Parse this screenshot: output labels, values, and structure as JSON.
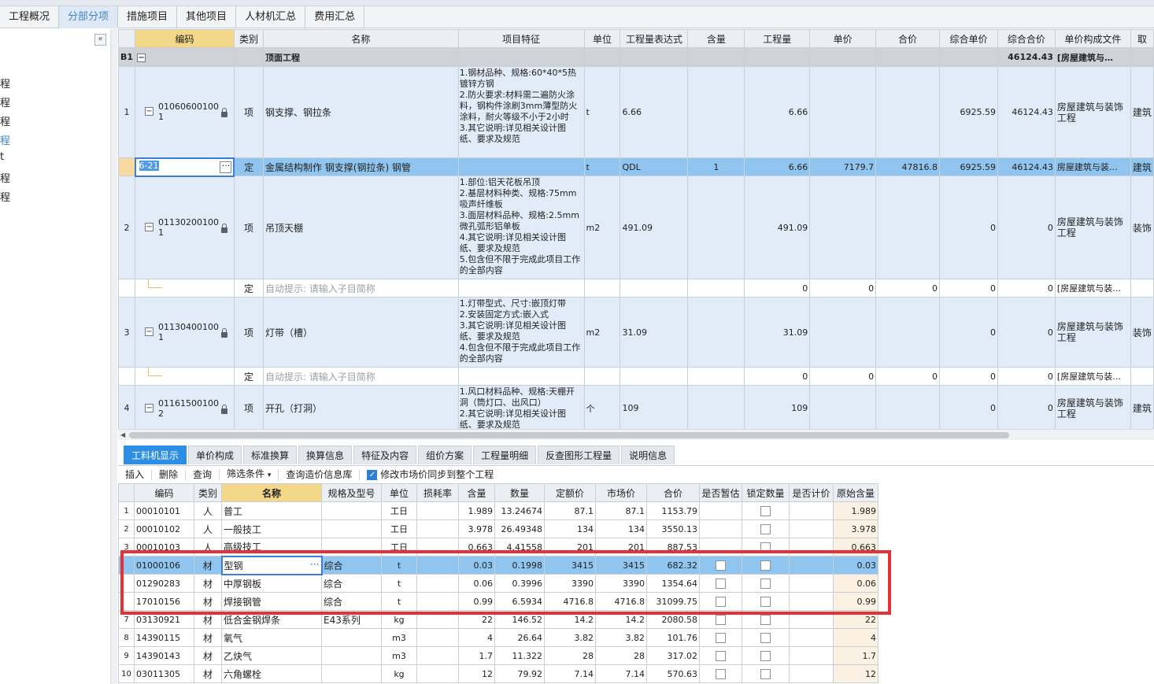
{
  "top_tabs": [
    "工程概况",
    "分部分项",
    "措施项目",
    "其他项目",
    "人材机汇总",
    "费用汇总"
  ],
  "active_top_tab": 1,
  "sidebar": {
    "collapse_label": "«",
    "items": [
      "程",
      "程",
      "程",
      "程",
      "t",
      "程",
      "程"
    ],
    "active_index": 3
  },
  "grid": {
    "headers": [
      "编码",
      "类别",
      "名称",
      "项目特征",
      "单位",
      "工程量表达式",
      "含量",
      "工程量",
      "单价",
      "合价",
      "综合单价",
      "综合合价",
      "单价构成文件",
      "取"
    ],
    "section": {
      "code": "B1",
      "toggle": "−",
      "name": "顶面工程",
      "total": "46124.43",
      "file": "[房屋建筑与…"
    },
    "rows": [
      {
        "no": "1",
        "code": "01060600100 1",
        "type": "项",
        "name": "钢支撑、钢拉条",
        "feature": "1.钢材品种、规格:60*40*5热镀锌方钢\n2.防火要求:材料需二遍防火涂料，钢构件涂刷3mm薄型防火涂料，耐火等级不小于2小时\n3.其它说明:详见相关设计图纸、要求及规范",
        "unit": "t",
        "expr": "6.66",
        "content": "",
        "qty": "6.66",
        "price": "",
        "amount": "",
        "cprice": "6925.59",
        "camount": "46124.43",
        "file": "房屋建筑与装饰工程",
        "fee": "建筑"
      },
      {
        "no": "",
        "code": "6-21",
        "type": "定",
        "name": "金属结构制作 钢支撑(钢拉条) 钢管",
        "feature": "",
        "unit": "t",
        "expr": "QDL",
        "content": "1",
        "qty": "6.66",
        "price": "7179.7",
        "amount": "47816.8",
        "cprice": "6925.59",
        "camount": "46124.43",
        "file": "房屋建筑与装…",
        "fee": "建筑"
      },
      {
        "no": "2",
        "code": "01130200100 1",
        "type": "项",
        "name": "吊顶天棚",
        "feature": "1.部位:铝天花板吊顶\n2.基层材料种类、规格:75mm吸声纤维板\n3.面层材料品种、规格:2.5mm微孔弧形铝单板\n4.其它说明:详见相关设计图纸、要求及规范\n5.包含但不限于完成此项目工作的全部内容",
        "unit": "m2",
        "expr": "491.09",
        "content": "",
        "qty": "491.09",
        "price": "",
        "amount": "",
        "cprice": "0",
        "camount": "0",
        "file": "房屋建筑与装饰工程",
        "fee": "装饰"
      },
      {
        "no": "",
        "code": "",
        "type": "定",
        "name": "自动提示: 请输入子目简称",
        "feature": "",
        "unit": "",
        "expr": "",
        "content": "",
        "qty": "0",
        "price": "0",
        "amount": "0",
        "cprice": "0",
        "camount": "0",
        "file": "[房屋建筑与装…",
        "fee": ""
      },
      {
        "no": "3",
        "code": "01130400100 1",
        "type": "项",
        "name": "灯带（槽）",
        "feature": "1.灯带型式、尺寸:嵌顶灯带\n2.安装固定方式:嵌入式\n3.其它说明:详见相关设计图纸、要求及规范\n4.包含但不限于完成此项目工作的全部内容",
        "unit": "m2",
        "expr": "31.09",
        "content": "",
        "qty": "31.09",
        "price": "",
        "amount": "",
        "cprice": "0",
        "camount": "0",
        "file": "房屋建筑与装饰工程",
        "fee": "装饰"
      },
      {
        "no": "",
        "code": "",
        "type": "定",
        "name": "自动提示: 请输入子目简称",
        "feature": "",
        "unit": "",
        "expr": "",
        "content": "",
        "qty": "0",
        "price": "0",
        "amount": "0",
        "cprice": "0",
        "camount": "0",
        "file": "[房屋建筑与装…",
        "fee": ""
      },
      {
        "no": "4",
        "code": "01161500100 2",
        "type": "项",
        "name": "开孔（打洞）",
        "feature": "1.风口材料品种、规格:天棚开洞（筒灯口、出风口）\n2.其它说明:详见相关设计图纸、要求及规范",
        "unit": "个",
        "expr": "109",
        "content": "",
        "qty": "109",
        "price": "",
        "amount": "",
        "cprice": "0",
        "camount": "0",
        "file": "房屋建筑与装饰工程",
        "fee": "建筑"
      }
    ]
  },
  "bottom_tabs": [
    "工料机显示",
    "单价构成",
    "标准换算",
    "换算信息",
    "特征及内容",
    "组价方案",
    "工程量明细",
    "反查图形工程量",
    "说明信息"
  ],
  "active_bottom_tab": 0,
  "toolbar": {
    "insert": "插入",
    "delete": "删除",
    "query": "查询",
    "filter": "筛选条件",
    "filter_arrow": "▾",
    "price_db": "查询造价信息库",
    "sync_label": "修改市场价同步到整个工程",
    "sync_checked": true
  },
  "materials": {
    "headers": [
      "",
      "编码",
      "类别",
      "名称",
      "规格及型号",
      "单位",
      "损耗率",
      "含量",
      "数量",
      "定额价",
      "市场价",
      "合价",
      "是否暂估",
      "锁定数量",
      "是否计价",
      "原始含量"
    ],
    "rows": [
      {
        "no": "1",
        "code": "00010101",
        "type": "人",
        "name": "普工",
        "spec": "",
        "unit": "工日",
        "loss": "",
        "content": "1.989",
        "qty": "13.24674",
        "base": "87.1",
        "market": "87.1",
        "amount": "1153.79",
        "est": false,
        "lock": true,
        "orig": "1.989"
      },
      {
        "no": "2",
        "code": "00010102",
        "type": "人",
        "name": "一般技工",
        "spec": "",
        "unit": "工日",
        "loss": "",
        "content": "3.978",
        "qty": "26.49348",
        "base": "134",
        "market": "134",
        "amount": "3550.13",
        "est": false,
        "lock": true,
        "orig": "3.978"
      },
      {
        "no": "3",
        "code": "00010103",
        "type": "人",
        "name": "高级技工",
        "spec": "",
        "unit": "工日",
        "loss": "",
        "content": "0.663",
        "qty": "4.41558",
        "base": "201",
        "market": "201",
        "amount": "887.53",
        "est": false,
        "lock": true,
        "orig": "0.663"
      },
      {
        "no": "",
        "code": "01000106",
        "type": "材",
        "name": "型钢",
        "spec": "综合",
        "unit": "t",
        "loss": "",
        "content": "0.03",
        "qty": "0.1998",
        "base": "3415",
        "market": "3415",
        "amount": "682.32",
        "est": true,
        "lock": true,
        "orig": "0.03"
      },
      {
        "no": "",
        "code": "01290283",
        "type": "材",
        "name": "中厚钢板",
        "spec": "综合",
        "unit": "t",
        "loss": "",
        "content": "0.06",
        "qty": "0.3996",
        "base": "3390",
        "market": "3390",
        "amount": "1354.64",
        "est": true,
        "lock": true,
        "orig": "0.06"
      },
      {
        "no": "",
        "code": "17010156",
        "type": "材",
        "name": "焊接钢管",
        "spec": "综合",
        "unit": "t",
        "loss": "",
        "content": "0.99",
        "qty": "6.5934",
        "base": "4716.8",
        "market": "4716.8",
        "amount": "31099.75",
        "est": true,
        "lock": true,
        "orig": "0.99"
      },
      {
        "no": "7",
        "code": "03130921",
        "type": "材",
        "name": "低合金钢焊条",
        "spec": "E43系列",
        "unit": "kg",
        "loss": "",
        "content": "22",
        "qty": "146.52",
        "base": "14.2",
        "market": "14.2",
        "amount": "2080.58",
        "est": true,
        "lock": true,
        "orig": "22"
      },
      {
        "no": "8",
        "code": "14390115",
        "type": "材",
        "name": "氧气",
        "spec": "",
        "unit": "m3",
        "loss": "",
        "content": "4",
        "qty": "26.64",
        "base": "3.82",
        "market": "3.82",
        "amount": "101.76",
        "est": true,
        "lock": true,
        "orig": "4"
      },
      {
        "no": "9",
        "code": "14390143",
        "type": "材",
        "name": "乙炔气",
        "spec": "",
        "unit": "m3",
        "loss": "",
        "content": "1.7",
        "qty": "11.322",
        "base": "28",
        "market": "28",
        "amount": "317.02",
        "est": true,
        "lock": true,
        "orig": "1.7"
      },
      {
        "no": "10",
        "code": "03011305",
        "type": "材",
        "name": "六角螺栓",
        "spec": "",
        "unit": "kg",
        "loss": "",
        "content": "12",
        "qty": "79.92",
        "base": "7.14",
        "market": "7.14",
        "amount": "570.63",
        "est": true,
        "lock": true,
        "orig": "12"
      }
    ],
    "selected_index": 3
  },
  "colors": {
    "accent": "#2d8ee5",
    "selected_row": "#90c5f0",
    "highlight_box": "#e63137"
  }
}
